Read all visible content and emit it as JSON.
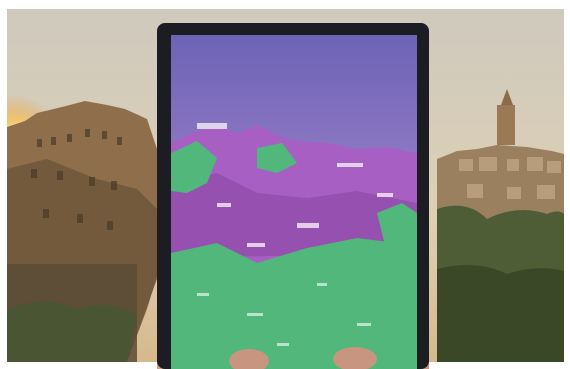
{
  "scene": {
    "border_color": "#ffffff",
    "sky_color": "#d3cbbd",
    "sun_color": "#f2c25c",
    "village_color": "#9c7a55",
    "foliage_color": "#4b5a33",
    "tablet_bezel_color": "#1c1d22",
    "screen_sky_top": "#6f64b8",
    "screen_sky_bottom": "#b892d4",
    "overlay_purple": "#a85fc4",
    "overlay_green": "#52b77a",
    "hand_color": "#d29d82"
  }
}
